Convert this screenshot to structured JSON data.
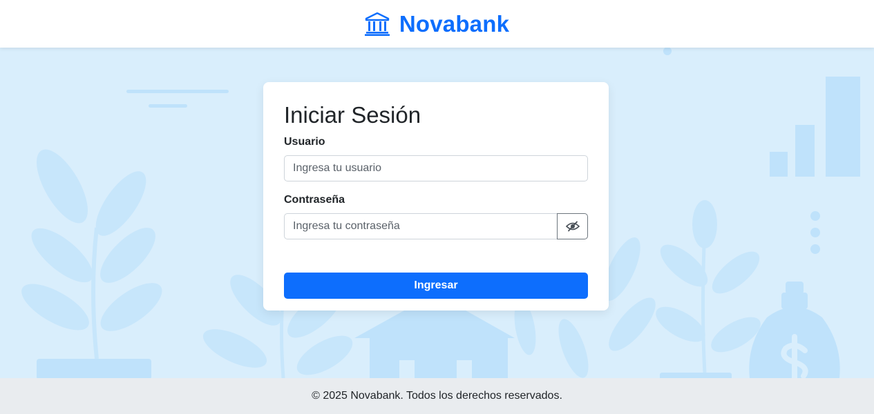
{
  "brand": {
    "name": "Novabank",
    "icon": "bank-building-icon",
    "color": "#0d6efd"
  },
  "login": {
    "title": "Iniciar Sesión",
    "username": {
      "label": "Usuario",
      "value": "",
      "placeholder": "Ingresa tu usuario"
    },
    "password": {
      "label": "Contraseña",
      "value": "",
      "placeholder": "Ingresa tu contraseña",
      "toggle_icon": "eye-slash-icon"
    },
    "submit_label": "Ingresar"
  },
  "footer": {
    "text": "© 2025 Novabank. Todos los derechos reservados."
  },
  "colors": {
    "primary": "#0d6efd",
    "background": "#d9eefc",
    "decoration": "#bfe2fb",
    "footer_bg": "#e9ecef"
  }
}
